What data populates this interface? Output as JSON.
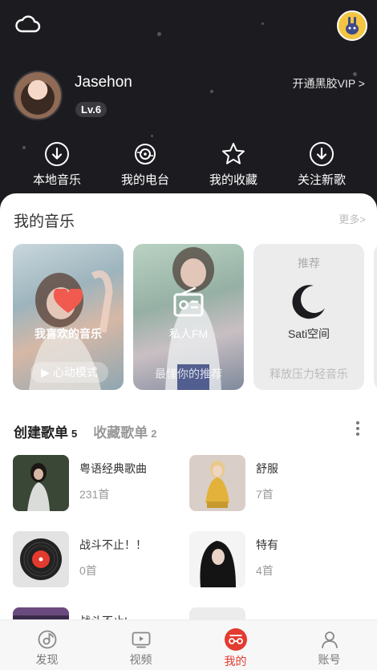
{
  "header": {
    "username": "Jasehon",
    "level": "Lv.6",
    "vip_link": "开通黑胶VIP >",
    "quick_actions": [
      {
        "label": "本地音乐",
        "icon": "download-circle-icon"
      },
      {
        "label": "我的电台",
        "icon": "radio-disc-icon"
      },
      {
        "label": "我的收藏",
        "icon": "star-icon"
      },
      {
        "label": "关注新歌",
        "icon": "download-circle-icon"
      }
    ]
  },
  "my_music": {
    "title": "我的音乐",
    "more": "更多>",
    "cards": [
      {
        "label": "我喜欢的音乐",
        "button": "▶ 心动模式",
        "icon": "heart-icon"
      },
      {
        "label": "私人FM",
        "subtitle": "最懂你的推荐",
        "icon": "radio-icon"
      },
      {
        "tag": "推荐",
        "label": "Sati空间",
        "subtitle": "释放压力轻音乐",
        "icon": "moon-icon"
      }
    ]
  },
  "playlists": {
    "tab_created": "创建歌单",
    "tab_created_count": "5",
    "tab_collected": "收藏歌单",
    "tab_collected_count": "2",
    "items": [
      {
        "name": "粤语经典歌曲",
        "count": "231首"
      },
      {
        "name": "舒服",
        "count": "7首"
      },
      {
        "name": "战斗不止！！",
        "count": "0首"
      },
      {
        "name": "特有",
        "count": "4首"
      },
      {
        "name": "战斗不止!",
        "count": ""
      },
      {
        "name": "",
        "count": ""
      }
    ]
  },
  "tabbar": {
    "items": [
      {
        "label": "发现"
      },
      {
        "label": "视频"
      },
      {
        "label": "我的"
      },
      {
        "label": "账号"
      }
    ]
  },
  "colors": {
    "accent": "#e33b30",
    "header_bg": "#1c1b20",
    "heart": "#f05a4f"
  }
}
